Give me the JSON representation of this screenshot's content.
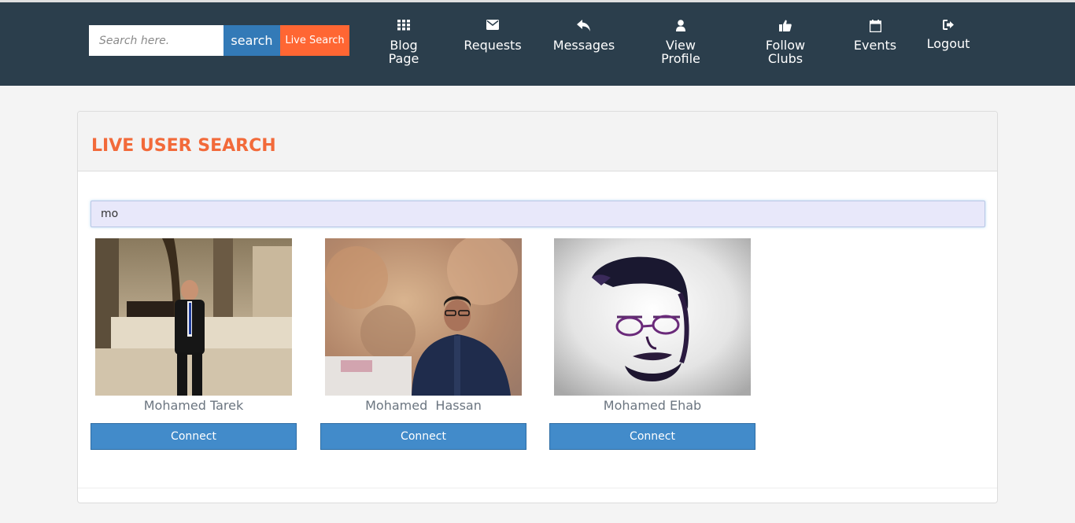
{
  "header": {
    "search_placeholder": "Search here.",
    "search_button": "search",
    "live_search_button": "Live Search"
  },
  "nav": {
    "blog_line1": "Blog",
    "blog_line2": "Page",
    "requests": "Requests",
    "messages": "Messages",
    "view_line1": "View",
    "view_line2": "Profile",
    "follow_line1": "Follow",
    "follow_line2": "Clubs",
    "events": "Events",
    "logout": "Logout",
    "icons": [
      "th-icon",
      "envelope-icon",
      "reply-icon",
      "user-icon",
      "thumbs-up-icon",
      "calendar-icon",
      "sign-out-icon"
    ]
  },
  "panel": {
    "title": "LIVE USER SEARCH",
    "search_value": "mo"
  },
  "results": [
    {
      "name": "Mohamed Tarek",
      "button": "Connect"
    },
    {
      "name": "Mohamed  Hassan",
      "button": "Connect"
    },
    {
      "name": "Mohamed Ehab",
      "button": "Connect"
    }
  ],
  "colors": {
    "topbar": "#2b3e4c",
    "accent_orange": "#ff6633",
    "primary_blue": "#337ab7",
    "connect_blue": "#428bca",
    "title_orange": "#f26a3a"
  }
}
